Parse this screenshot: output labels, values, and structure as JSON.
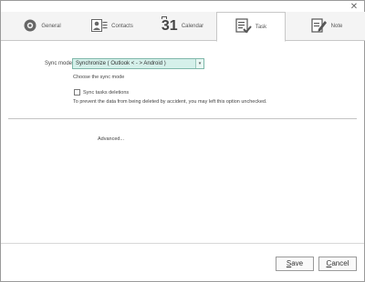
{
  "window": {
    "close_glyph": "✕"
  },
  "tabs": [
    {
      "label": "General",
      "icon": "gear-icon",
      "active": false
    },
    {
      "label": "Contacts",
      "icon": "contacts-icon",
      "active": false
    },
    {
      "label": "Calendar",
      "icon": "calendar-icon",
      "icon_text": "31",
      "active": false
    },
    {
      "label": "Task",
      "icon": "task-checklist-icon",
      "active": true
    },
    {
      "label": "Note",
      "icon": "note-pencil-icon",
      "active": false
    }
  ],
  "sync": {
    "label": "Sync mode:",
    "selected": "Synchronize  ( Outlook < - > Android )",
    "hint": "Choose the sync mode",
    "checkbox_label": "Sync tasks deletions",
    "checkbox_checked": false,
    "checkbox_hint": "To prevent the data from being deleted by accident, you may left this option unchecked."
  },
  "advanced_label": "Advanced...",
  "buttons": {
    "save_accel": "S",
    "save_rest": "ave",
    "cancel_accel": "C",
    "cancel_rest": "ancel"
  },
  "colors": {
    "select_bg": "#d5f0ea",
    "select_border": "#7fb8aa",
    "tab_bg": "#f4f4f4"
  }
}
